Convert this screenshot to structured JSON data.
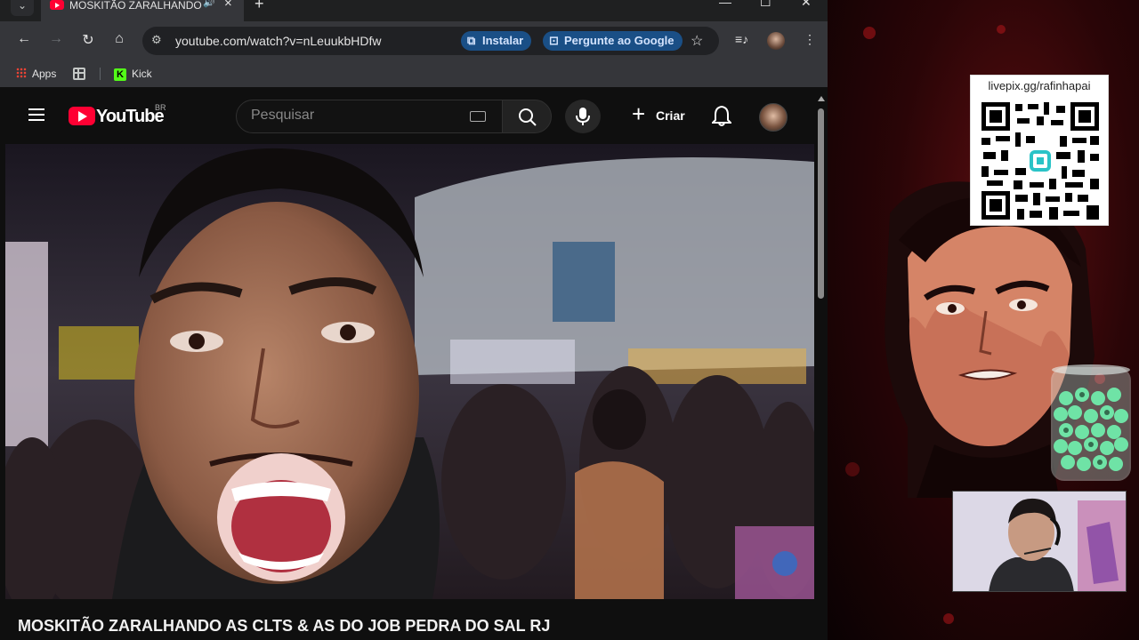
{
  "browser": {
    "tab": {
      "title": "MOSKITÃO ZARALHANDO AS CLTS & AS DO JOB PEDRA DO SAL RJ",
      "audio_icon": "speaker-icon"
    },
    "window_controls": {
      "minimize": "—",
      "maximize": "☐",
      "close": "✕"
    },
    "new_tab": "+",
    "address": {
      "url": "youtube.com/watch?v=nLeuukbHDfw"
    },
    "chips": {
      "install": "Instalar",
      "ask_google": "Pergunte ao Google"
    },
    "bookmarks": [
      {
        "label": "Apps",
        "icon": "apps-icon"
      },
      {
        "label": "Kick",
        "icon": "kick-icon"
      }
    ]
  },
  "youtube": {
    "logo_text": "YouTube",
    "region": "BR",
    "search_placeholder": "Pesquisar",
    "create_label": "Criar",
    "video_title": "MOSKITÃO ZARALHANDO AS CLTS & AS DO JOB PEDRA DO SAL RJ"
  },
  "stream_overlay": {
    "qr_url": "livepix.gg/rafinhapai"
  },
  "colors": {
    "browser_toolbar": "#35363a",
    "youtube_red": "#ff0033",
    "chip_blue": "#1a4f86",
    "stream_red": "#b0161a"
  }
}
